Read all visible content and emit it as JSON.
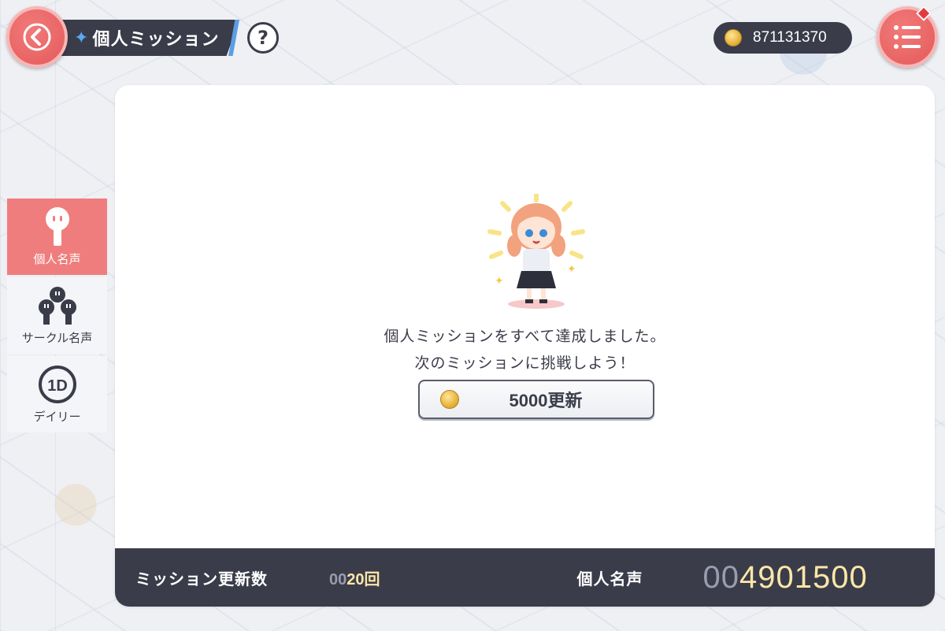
{
  "header": {
    "title": "個人ミッション",
    "title_icon": "sparkle-icon",
    "help_label": "?",
    "currency": "871131370"
  },
  "sidebar": {
    "items": [
      {
        "label": "個人名声",
        "icon": "person-icon",
        "active": true
      },
      {
        "label": "サークル名声",
        "icon": "group-icon",
        "active": false
      },
      {
        "label": "デイリー",
        "icon": "1d-icon",
        "badge": "1D",
        "active": false
      }
    ]
  },
  "main": {
    "message_line1": "個人ミッションをすべて達成しました。",
    "message_line2": "次のミッションに挑戦しよう！",
    "renew_button": "5000更新"
  },
  "footer": {
    "renew_count_label": "ミッション更新数",
    "renew_count_prefix": "00",
    "renew_count_value": "20",
    "renew_count_unit": "回",
    "fame_label": "個人名声",
    "fame_prefix": "00",
    "fame_value": "4901500"
  },
  "colors": {
    "accent_red": "#f07d7d",
    "dark": "#3a3c4a",
    "highlight_blue": "#5aa8f0",
    "gold": "#fbe7a8"
  }
}
